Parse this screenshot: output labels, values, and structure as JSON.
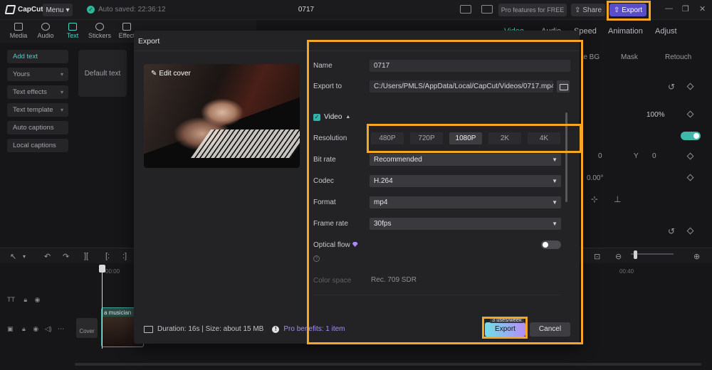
{
  "app": {
    "logo_text": "CapCut",
    "menu_label": "Menu",
    "autosave_text": "Auto saved: 22:36:12",
    "project_title": "0717",
    "pro_features_label": "Pro features for FREE",
    "share_label": "Share",
    "export_label": "Export"
  },
  "tools": [
    {
      "label": "Media",
      "icon": "media-icon"
    },
    {
      "label": "Audio",
      "icon": "audio-icon"
    },
    {
      "label": "Text",
      "icon": "text-icon"
    },
    {
      "label": "Stickers",
      "icon": "stickers-icon"
    },
    {
      "label": "Effect",
      "icon": "effects-icon"
    }
  ],
  "sidebar": {
    "items": [
      {
        "label": "Add text"
      },
      {
        "label": "Yours"
      },
      {
        "label": "Text effects"
      },
      {
        "label": "Text template"
      },
      {
        "label": "Auto captions"
      },
      {
        "label": "Local captions"
      }
    ],
    "default_text_card": "Default text"
  },
  "right_panel": {
    "tabs": [
      "Video",
      "Audio",
      "Speed",
      "Animation",
      "Adjust"
    ],
    "subtabs": [
      "re BG",
      "Mask",
      "Retouch"
    ],
    "scale_value": "100%",
    "pos_x": "0",
    "pos_y_label": "Y",
    "pos_y": "0",
    "rotation": "0.00°"
  },
  "timeline": {
    "ruler_start": "00:00",
    "ruler_40": "00:40",
    "cover_label": "Cover",
    "clip_label": "a musician"
  },
  "dialog": {
    "title": "Export",
    "edit_cover": "Edit cover",
    "name_label": "Name",
    "name_value": "0717",
    "export_to_label": "Export to",
    "export_to_value": "C:/Users/PMLS/AppData/Local/CapCut/Videos/0717.mp4",
    "video_section": "Video",
    "resolution_label": "Resolution",
    "resolution_options": [
      "480P",
      "720P",
      "1080P",
      "2K",
      "4K"
    ],
    "resolution_selected": "1080P",
    "bitrate_label": "Bit rate",
    "bitrate_value": "Recommended",
    "codec_label": "Codec",
    "codec_value": "H.264",
    "format_label": "Format",
    "format_value": "mp4",
    "framerate_label": "Frame rate",
    "framerate_value": "30fps",
    "optical_flow_label": "Optical flow",
    "color_space_label": "Color space",
    "color_space_value": "Rec. 709 SDR",
    "duration_size": "Duration: 16s | Size: about 15 MB",
    "pro_benefits": "Pro benefits: 1 item",
    "uses_badge": "3 uses/week",
    "export_button": "Export",
    "cancel_button": "Cancel"
  },
  "colors": {
    "accent_teal": "#4fd1c5",
    "export_purple": "#5a4dc9",
    "highlight_orange": "#f5a623",
    "pro_purple": "#a78bfa"
  }
}
